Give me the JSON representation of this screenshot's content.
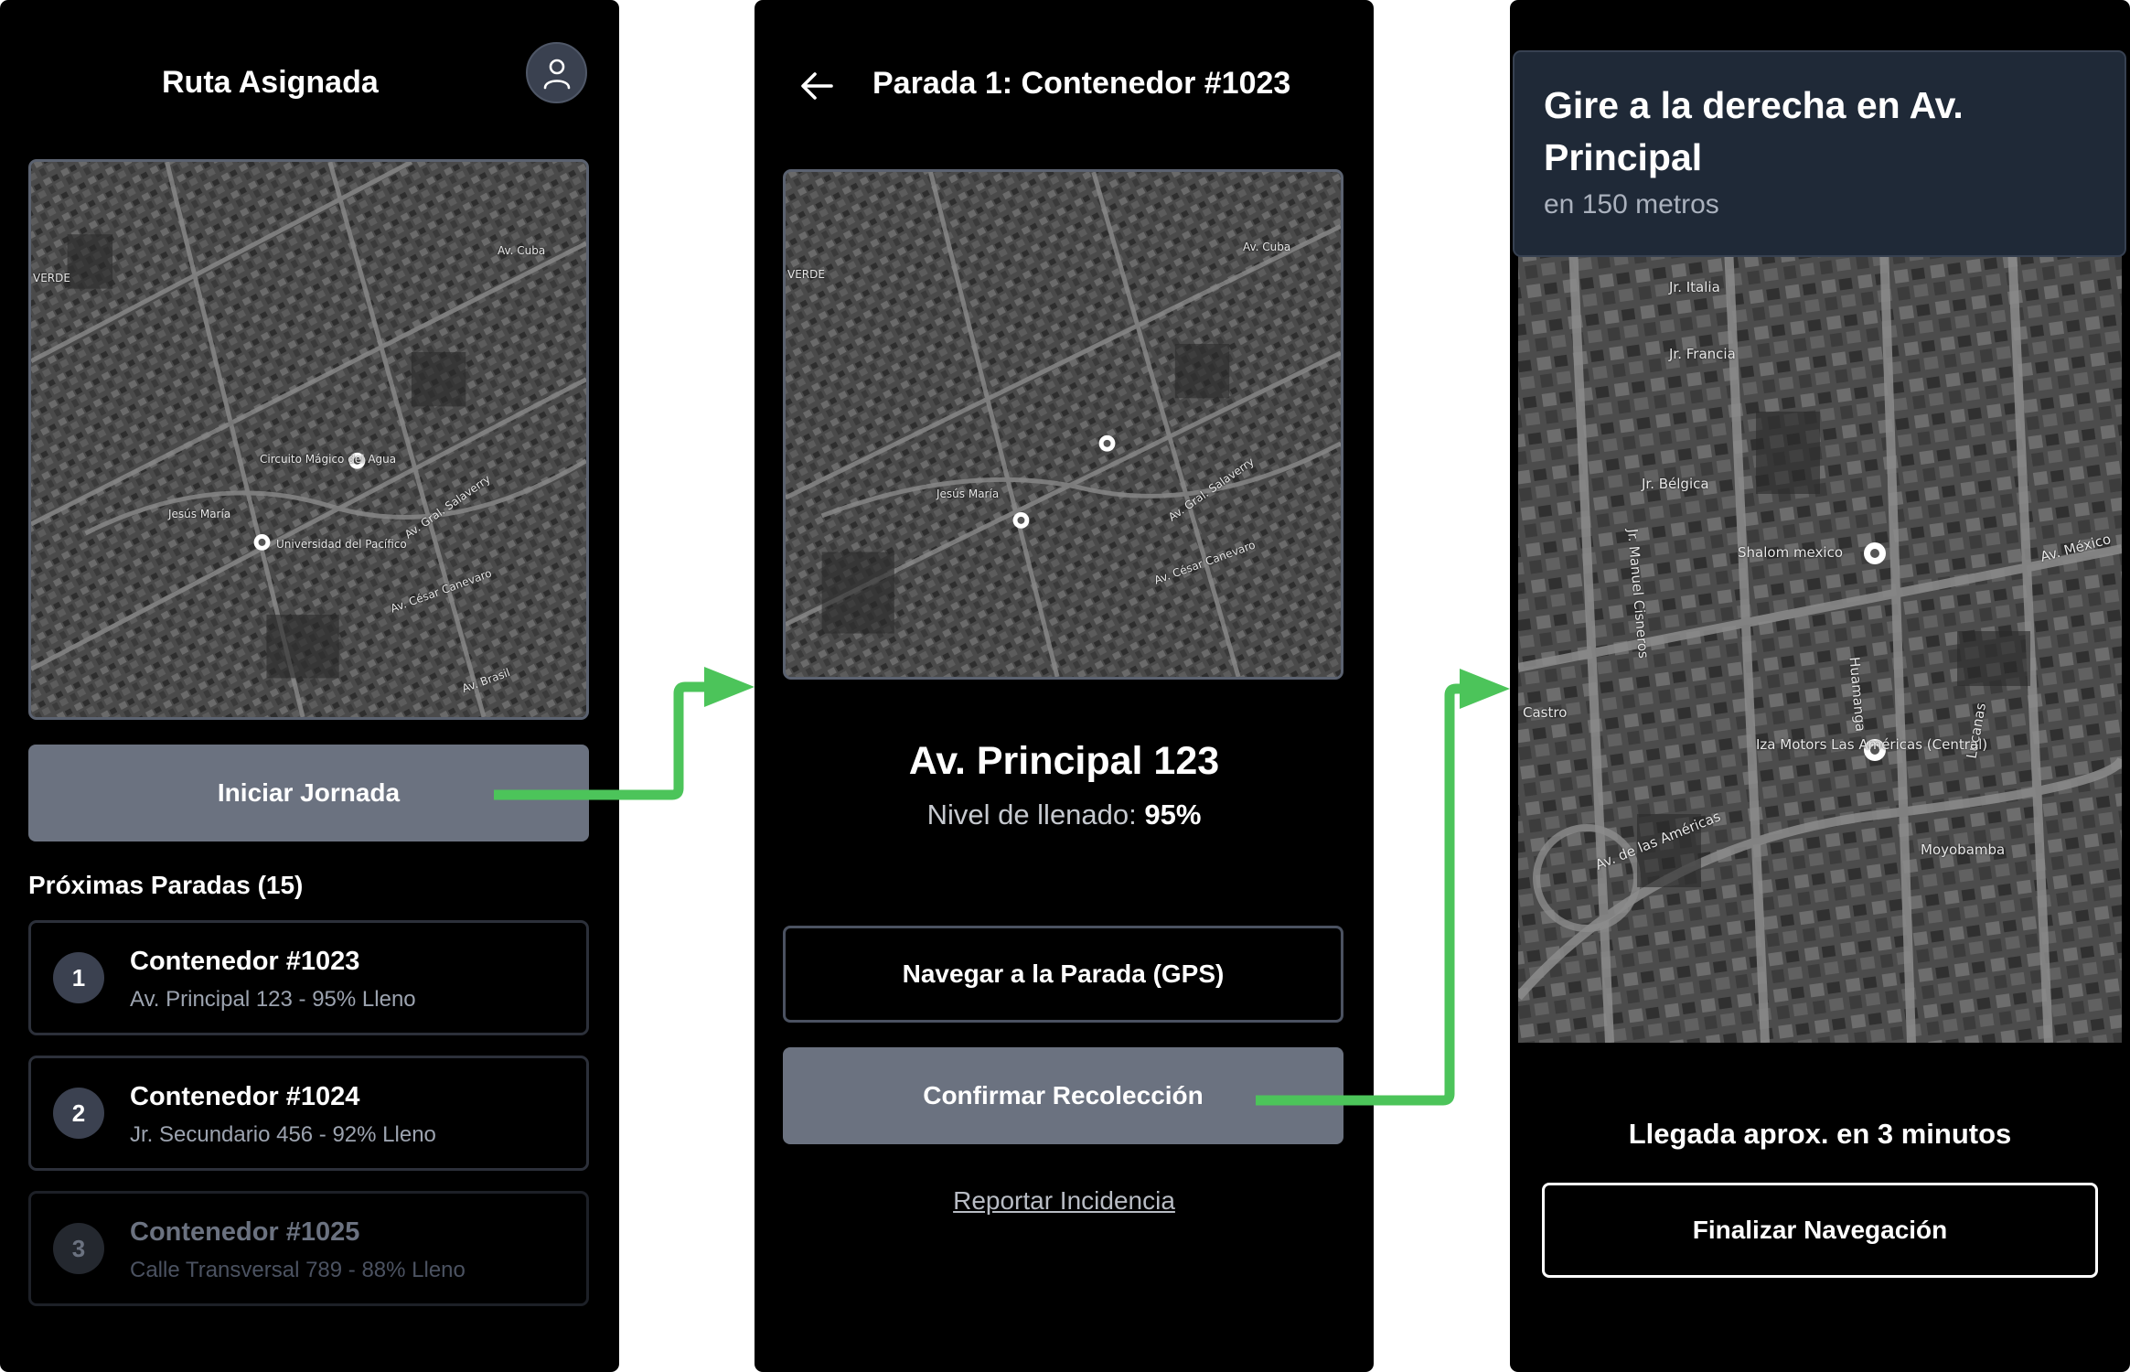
{
  "screen1": {
    "title": "Ruta Asignada",
    "start_button": "Iniciar Jornada",
    "stops_title": "Próximas Paradas (15)",
    "stops": [
      {
        "number": "1",
        "name": "Contenedor #1023",
        "detail": "Av. Principal 123 - 95% Lleno"
      },
      {
        "number": "2",
        "name": "Contenedor #1024",
        "detail": "Jr. Secundario 456 - 92% Lleno"
      },
      {
        "number": "3",
        "name": "Contenedor #1025",
        "detail": "Calle Transversal 789 - 88% Lleno"
      }
    ],
    "map_labels": [
      "Jesús María",
      "Universidad del Pacífico",
      "Circuito Mágico del Agua",
      "Av. César Canevaro",
      "Av. Gral. Salaverry",
      "VERDE",
      "Av. Cuba",
      "Av. Brasil"
    ]
  },
  "screen2": {
    "title": "Parada 1: Contenedor #1023",
    "address": "Av. Principal 123",
    "fill_label": "Nivel de llenado:",
    "fill_value": "95%",
    "navigate_button": "Navegar a la Parada (GPS)",
    "confirm_button": "Confirmar Recolección",
    "report_link": "Reportar Incidencia",
    "map_labels": [
      "Jesús María",
      "VERDE",
      "Av. Gral. Salaverry",
      "Av. César Canevaro",
      "Av. Cuba"
    ]
  },
  "screen3": {
    "instruction": "Gire a la derecha en Av. Principal",
    "distance": "en 150 metros",
    "eta": "Llegada aprox. en 3 minutos",
    "finish_button": "Finalizar Navegación",
    "map_labels": [
      "Jr. Italia",
      "Jr. Francia",
      "Jr. Bélgica",
      "Shalom mexico",
      "Av. México",
      "Av. de las Américas",
      "Lucanas",
      "Huamanga",
      "Jr. Manuel Cisneros",
      "Iza Motors Las Américas (Central)",
      "Moyobamba",
      "Castro"
    ]
  },
  "colors": {
    "screen_bg": "#000000",
    "button_gray": "#6b7280",
    "flow_arrow": "#4cc45a",
    "banner_bg": "#1f2937"
  }
}
